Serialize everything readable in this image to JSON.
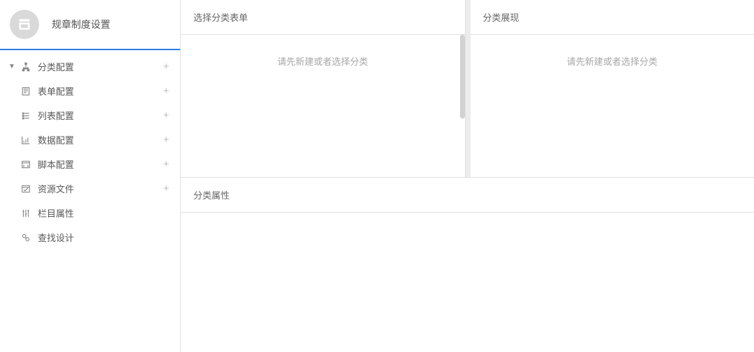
{
  "sidebar": {
    "title": "规章制度设置",
    "items": [
      {
        "label": "分类配置",
        "icon": "sitemap",
        "expandable": true,
        "addable": true
      },
      {
        "label": "表单配置",
        "icon": "form",
        "expandable": false,
        "addable": true
      },
      {
        "label": "列表配置",
        "icon": "list",
        "expandable": false,
        "addable": true
      },
      {
        "label": "数据配置",
        "icon": "chart",
        "expandable": false,
        "addable": true
      },
      {
        "label": "脚本配置",
        "icon": "script",
        "expandable": false,
        "addable": true
      },
      {
        "label": "资源文件",
        "icon": "file",
        "expandable": false,
        "addable": true
      },
      {
        "label": "栏目属性",
        "icon": "sliders",
        "expandable": false,
        "addable": false
      },
      {
        "label": "查找设计",
        "icon": "search",
        "expandable": false,
        "addable": false
      }
    ]
  },
  "panes": {
    "selectForm": {
      "title": "选择分类表单",
      "placeholder": "请先新建或者选择分类"
    },
    "display": {
      "title": "分类展现",
      "placeholder": "请先新建或者选择分类"
    },
    "properties": {
      "title": "分类属性"
    }
  }
}
